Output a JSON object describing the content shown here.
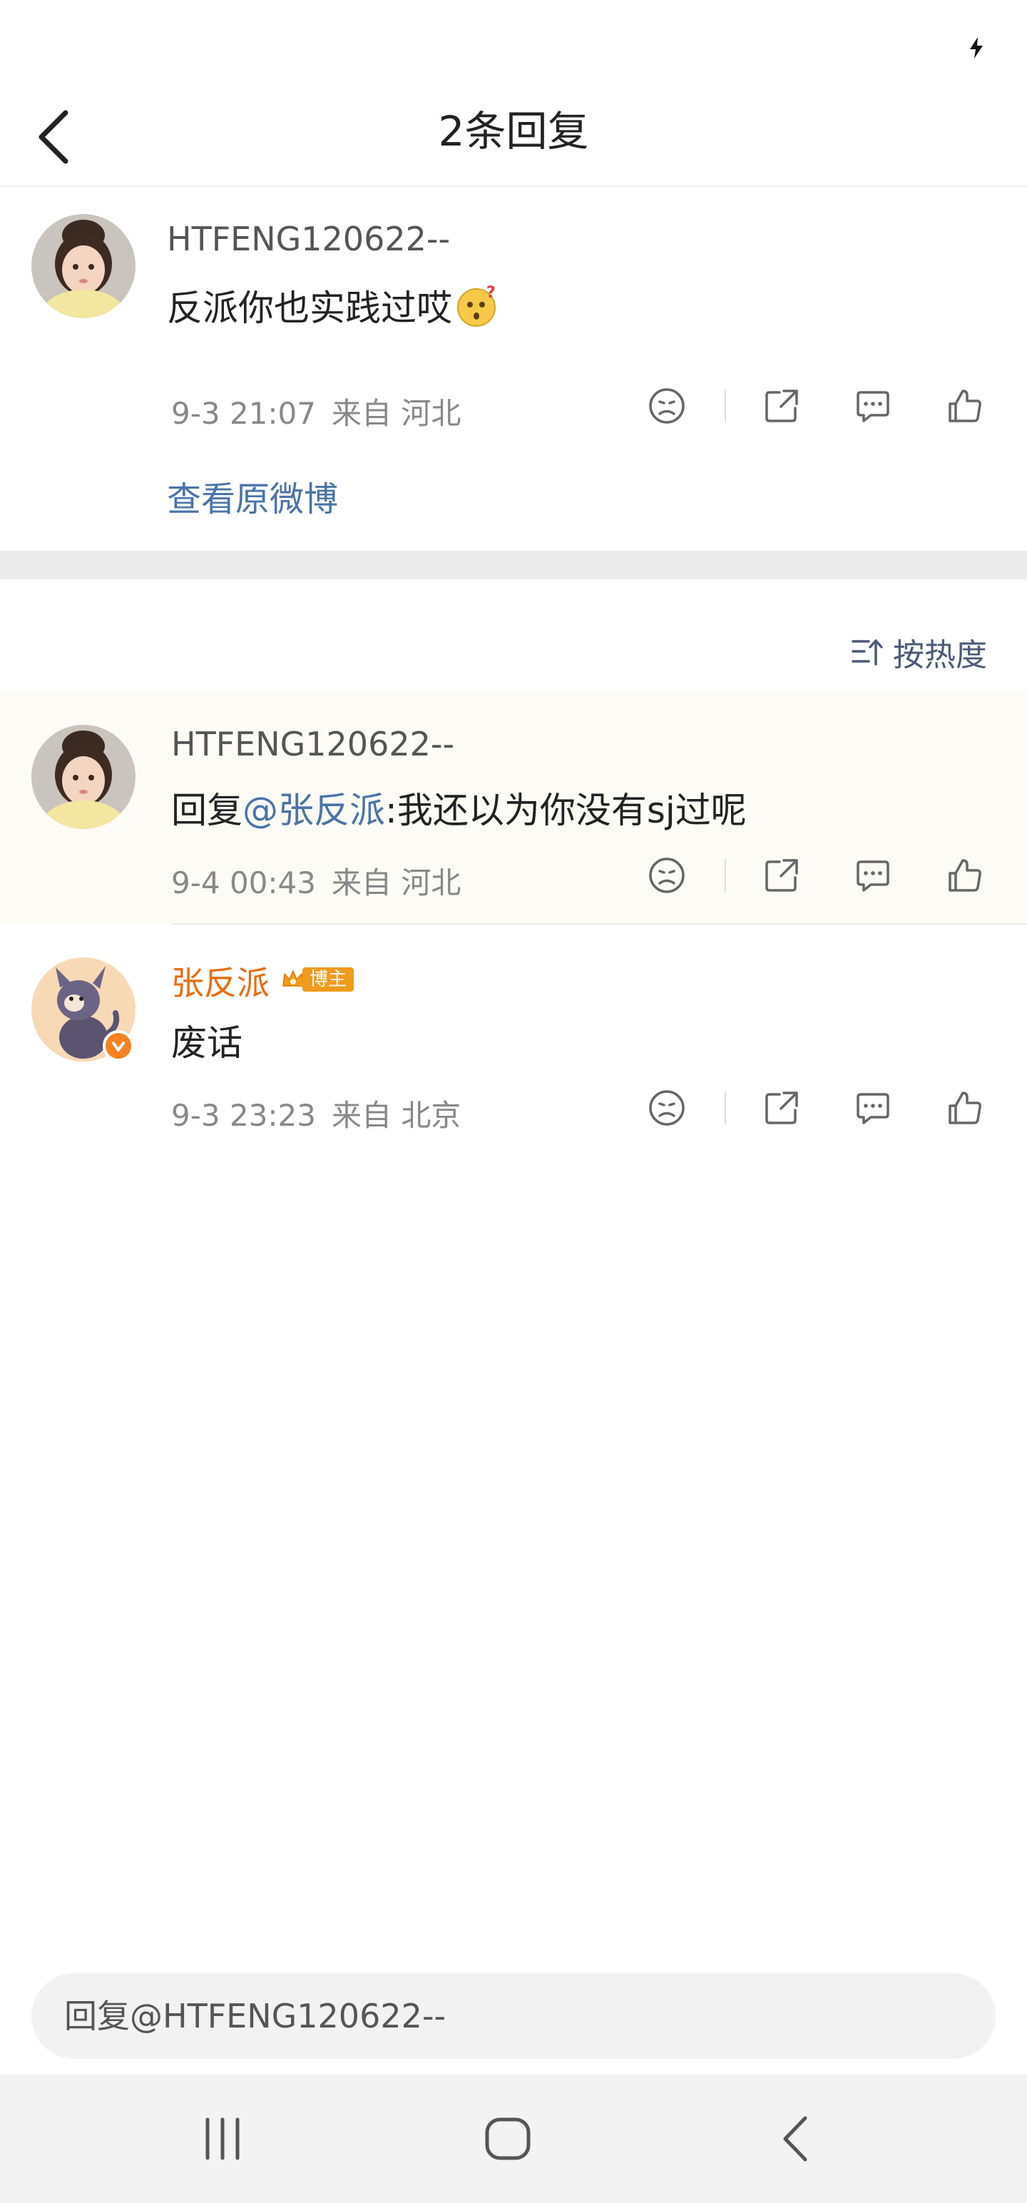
{
  "nav": {
    "title": "2条回复"
  },
  "post": {
    "username": "HTFENG120622--",
    "content": "反派你也实践过哎",
    "time": "9-3 21:07",
    "source": "来自 河北",
    "view_original": "查看原微博"
  },
  "sort": {
    "label": "按热度"
  },
  "replies": [
    {
      "username": "HTFENG120622--",
      "content_prefix": "回复",
      "mention": "@张反派",
      "content_rest": ":我还以为你没有sj过呢",
      "time": "9-4 00:43",
      "source": "来自 河北"
    },
    {
      "username": "张反派",
      "badge": "博主",
      "content": "废话",
      "time": "9-3 23:23",
      "source": "来自 北京"
    }
  ],
  "reply_input": {
    "placeholder": "回复@HTFENG120622--"
  },
  "colors": {
    "accent_blue": "#4a74a8",
    "username_orange": "#e86b0f",
    "badge_orange": "#f29a1b"
  }
}
